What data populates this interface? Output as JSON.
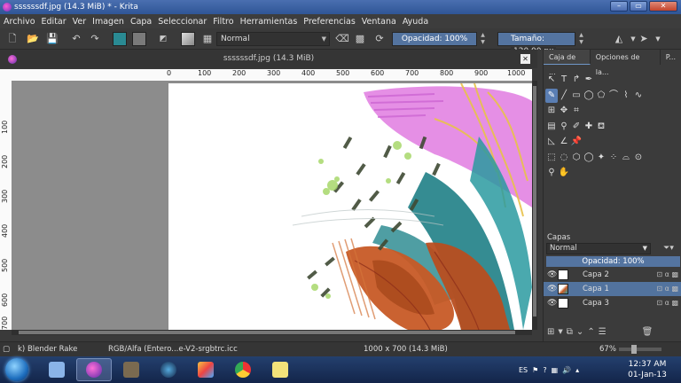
{
  "window": {
    "title": "ssssssdf.jpg (14.3 MiB) * - Krita",
    "controls": [
      "–",
      "▭",
      "✕"
    ]
  },
  "menu": [
    "Archivo",
    "Editar",
    "Ver",
    "Imagen",
    "Capa",
    "Seleccionar",
    "Filtro",
    "Herramientas",
    "Preferencias",
    "Ventana",
    "Ayuda"
  ],
  "toolbar": {
    "blend_mode": "Normal",
    "opacity_label": "Opacidad:  100%",
    "size_label": "Tamaño:",
    "size_value": "120.00 px",
    "fg_color": "#2a8a93",
    "bg_color": "#7a7a7a"
  },
  "document": {
    "tab_title": "ssssssdf.jpg (14.3 MiB)",
    "ruler_top": [
      "0",
      "100",
      "200",
      "300",
      "400",
      "500",
      "600",
      "700",
      "800",
      "900",
      "1000"
    ],
    "ruler_left": [
      "100",
      "200",
      "300",
      "400",
      "500",
      "600",
      "700"
    ]
  },
  "dock": {
    "tabs": [
      "Caja de ...",
      "Opciones de la...",
      "P..."
    ],
    "layers_title": "Capas",
    "blend_mode": "Normal",
    "opacity": "Opacidad:  100%",
    "layers": [
      {
        "name": "Capa 2",
        "active": false
      },
      {
        "name": "Capa 1",
        "active": true
      },
      {
        "name": "Capa 3",
        "active": false
      }
    ]
  },
  "status": {
    "brush": "k) Blender Rake",
    "color_space": "RGB/Alfa (Entero...e-V2-srgbtrc.icc",
    "image_size": "1000 x 700 (14.3 MiB)",
    "zoom": "67%"
  },
  "taskbar": {
    "language": "ES",
    "time": "12:37 AM",
    "date": "01-Jan-13"
  }
}
